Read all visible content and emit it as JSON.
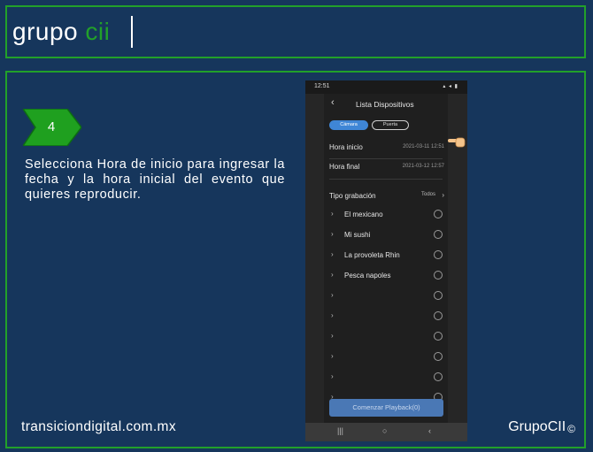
{
  "header": {
    "logo_main": "grupo ",
    "logo_accent": "cii"
  },
  "step": {
    "number": "4"
  },
  "instruction": "Selecciona Hora de inicio para ingresar la fecha y la hora inicial del evento que quieres reproducir.",
  "footer": {
    "url": "transiciondigital.com.mx",
    "brand": "GrupoCII",
    "copyright": "©"
  },
  "phone": {
    "status_time": "12:51",
    "status_icons": "▴ ◂ ▮",
    "title": "Lista Dispositivos",
    "segments": {
      "camera": "Cámara",
      "door": "Puerta"
    },
    "start_label": "Hora inicio",
    "start_value": "2021-03-11 12:51",
    "end_label": "Hora final",
    "end_value": "2021-03-12 12:57",
    "record_type_label": "Tipo grabación",
    "record_type_value": "Todos",
    "devices": [
      "El mexicano",
      "Mi sushi",
      "La provoleta Rhin",
      "Pesca napoles"
    ],
    "playback_button": "Comenzar Playback(0)",
    "nav": {
      "recent": "|||",
      "home": "○",
      "back": "‹"
    }
  },
  "colors": {
    "background": "#16365c",
    "accent": "#22a02a",
    "button": "#4a78b5"
  },
  "icons": {
    "back": "chevron-left-icon",
    "pointer": "pointing-hand-icon",
    "step": "chevron-badge-icon"
  }
}
